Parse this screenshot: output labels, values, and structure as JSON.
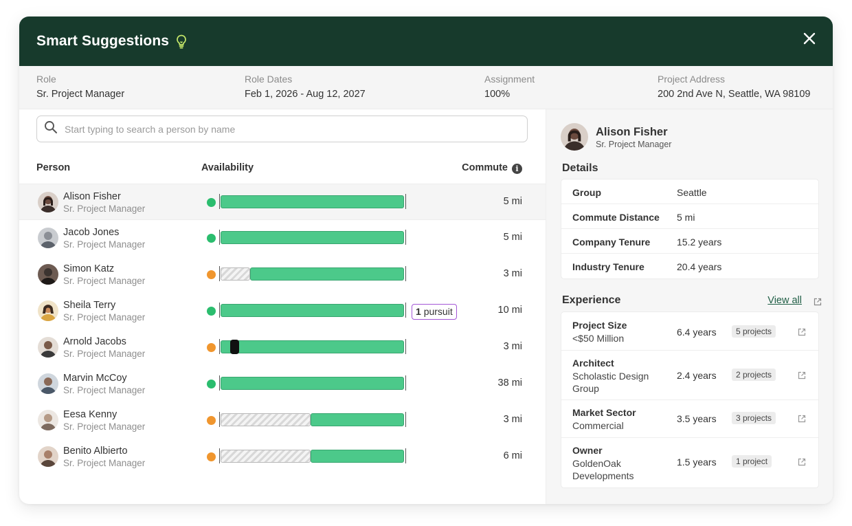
{
  "modal": {
    "title": "Smart Suggestions"
  },
  "info": {
    "role_label": "Role",
    "role_value": "Sr. Project Manager",
    "dates_label": "Role Dates",
    "dates_value": "Feb 1, 2026 - Aug 12, 2027",
    "assignment_label": "Assignment",
    "assignment_value": "100%",
    "address_label": "Project Address",
    "address_value": "200 2nd Ave N, Seattle, WA 98109"
  },
  "search": {
    "placeholder": "Start typing to search a person by name"
  },
  "columns": {
    "person": "Person",
    "availability": "Availability",
    "commute": "Commute"
  },
  "people": [
    {
      "name": "Alison Fisher",
      "role": "Sr. Project Manager",
      "status": "green",
      "commute": "5 mi",
      "avatar_color": "#6b4a3e"
    },
    {
      "name": "Jacob Jones",
      "role": "Sr. Project Manager",
      "status": "green",
      "commute": "5 mi",
      "avatar_color": "#8b8f96"
    },
    {
      "name": "Simon Katz",
      "role": "Sr. Project Manager",
      "status": "orange",
      "commute": "3 mi",
      "avatar_color": "#3c3430"
    },
    {
      "name": "Sheila Terry",
      "role": "Sr. Project Manager",
      "status": "green",
      "commute": "10 mi",
      "avatar_color": "#d9a441",
      "pursuit_count": "1",
      "pursuit_label": "pursuit"
    },
    {
      "name": "Arnold Jacobs",
      "role": "Sr. Project Manager",
      "status": "orange",
      "commute": "3 mi",
      "avatar_color": "#7a5a48"
    },
    {
      "name": "Marvin McCoy",
      "role": "Sr. Project Manager",
      "status": "green",
      "commute": "38 mi",
      "avatar_color": "#4a5868"
    },
    {
      "name": "Eesa Kenny",
      "role": "Sr. Project Manager",
      "status": "orange",
      "commute": "3 mi",
      "avatar_color": "#b59a86"
    },
    {
      "name": "Benito Albierto",
      "role": "Sr. Project Manager",
      "status": "orange",
      "commute": "6 mi",
      "avatar_color": "#a8806a"
    }
  ],
  "profile": {
    "name": "Alison Fisher",
    "role": "Sr. Project Manager"
  },
  "details": {
    "title": "Details",
    "rows": [
      {
        "label": "Group",
        "value": "Seattle"
      },
      {
        "label": "Commute Distance",
        "value": "5 mi"
      },
      {
        "label": "Company Tenure",
        "value": "15.2 years"
      },
      {
        "label": "Industry Tenure",
        "value": "20.4 years"
      }
    ]
  },
  "experience": {
    "title": "Experience",
    "view_all": "View all",
    "rows": [
      {
        "label": "Project Size",
        "sub": "<$50 Million",
        "value": "6.4 years",
        "badge": "5 projects"
      },
      {
        "label": "Architect",
        "sub": "Scholastic Design Group",
        "value": "2.4 years",
        "badge": "2 projects"
      },
      {
        "label": "Market Sector",
        "sub": "Commercial",
        "value": "3.5 years",
        "badge": "3 projects"
      },
      {
        "label": "Owner",
        "sub": "GoldenOak Developments",
        "value": "1.5 years",
        "badge": "1 project"
      }
    ]
  },
  "colors": {
    "header": "#173a2c",
    "available": "#4cc98a",
    "status_green": "#2bbd6e",
    "status_orange": "#f0962e",
    "pursuit_border": "#a356d6",
    "link": "#1f5e45"
  }
}
